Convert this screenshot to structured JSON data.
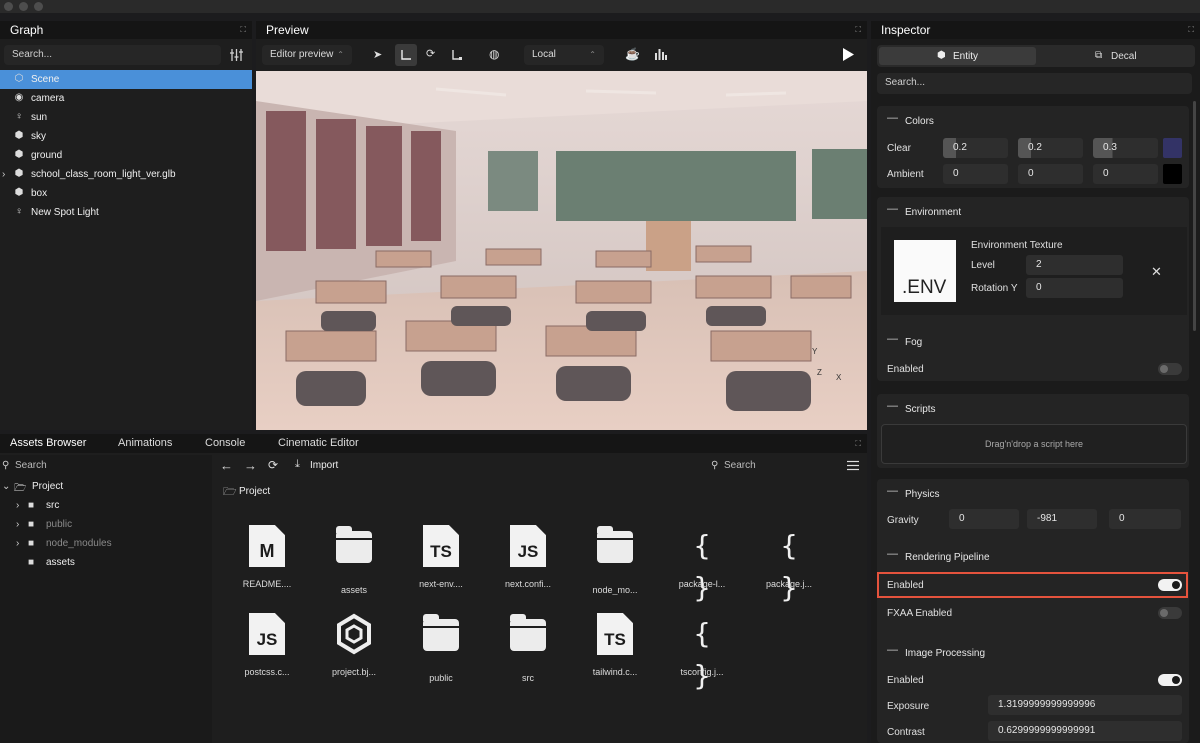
{
  "graph": {
    "title": "Graph",
    "search_placeholder": "Search...",
    "items": [
      {
        "label": "Scene",
        "icon": "scene-icon",
        "selected": true
      },
      {
        "label": "camera",
        "icon": "camera-icon"
      },
      {
        "label": "sun",
        "icon": "light-icon"
      },
      {
        "label": "sky",
        "icon": "mesh-icon"
      },
      {
        "label": "ground",
        "icon": "mesh-icon"
      },
      {
        "label": "school_class_room_light_ver.glb",
        "icon": "mesh-icon",
        "expandable": true
      },
      {
        "label": "box",
        "icon": "mesh-icon"
      },
      {
        "label": "New Spot Light",
        "icon": "light-icon"
      }
    ]
  },
  "preview": {
    "title": "Preview",
    "mode": "Editor preview",
    "space": "Local",
    "axis_labels": [
      "Y",
      "Z",
      "X"
    ]
  },
  "bottom": {
    "tabs": [
      "Assets Browser",
      "Animations",
      "Console",
      "Cinematic Editor"
    ],
    "search_placeholder": "Search",
    "import_label": "Import",
    "breadcrumb": "Project",
    "tree": [
      {
        "label": "Project",
        "open": true
      },
      {
        "label": "src"
      },
      {
        "label": "public",
        "dim": true
      },
      {
        "label": "node_modules",
        "dim": true
      },
      {
        "label": "assets"
      }
    ],
    "files": [
      {
        "name": "README....",
        "kind": "doc",
        "badge": "M"
      },
      {
        "name": "assets",
        "kind": "folder"
      },
      {
        "name": "next-env....",
        "kind": "doc",
        "badge": "TS"
      },
      {
        "name": "next.confi...",
        "kind": "doc",
        "badge": "JS"
      },
      {
        "name": "node_mo...",
        "kind": "folder"
      },
      {
        "name": "package-l...",
        "kind": "json"
      },
      {
        "name": "package.j...",
        "kind": "json"
      },
      {
        "name": "postcss.c...",
        "kind": "doc",
        "badge": "JS"
      },
      {
        "name": "project.bj...",
        "kind": "hex"
      },
      {
        "name": "public",
        "kind": "folder"
      },
      {
        "name": "src",
        "kind": "folder"
      },
      {
        "name": "tailwind.c...",
        "kind": "doc",
        "badge": "TS"
      },
      {
        "name": "tsconfig.j...",
        "kind": "json"
      }
    ]
  },
  "inspector": {
    "title": "Inspector",
    "tabs": [
      "Entity",
      "Decal"
    ],
    "search_placeholder": "Search...",
    "colors": {
      "title": "Colors",
      "clear_label": "Clear",
      "clear": [
        "0.2",
        "0.2",
        "0.3"
      ],
      "ambient_label": "Ambient",
      "ambient": [
        "0",
        "0",
        "0"
      ],
      "clear_swatch": "#333366",
      "ambient_swatch": "#000000"
    },
    "environment": {
      "title": "Environment",
      "thumb": ".ENV",
      "texture_label": "Environment Texture",
      "level_label": "Level",
      "level": "2",
      "rotation_label": "Rotation Y",
      "rotation": "0"
    },
    "fog": {
      "title": "Fog",
      "enabled_label": "Enabled",
      "enabled": false
    },
    "scripts": {
      "title": "Scripts",
      "drop": "Drag'n'drop a script here"
    },
    "physics": {
      "title": "Physics",
      "gravity_label": "Gravity",
      "gravity": [
        "0",
        "-981",
        "0"
      ]
    },
    "pipeline": {
      "title": "Rendering Pipeline",
      "enabled_label": "Enabled",
      "enabled": true,
      "fxaa_label": "FXAA Enabled",
      "fxaa": false
    },
    "image": {
      "title": "Image Processing",
      "enabled_label": "Enabled",
      "enabled": true,
      "exposure_label": "Exposure",
      "exposure": "1.3199999999999996",
      "contrast_label": "Contrast",
      "contrast": "0.6299999999999991"
    }
  },
  "accent": "#4a90d9",
  "highlight": "#e5533d"
}
